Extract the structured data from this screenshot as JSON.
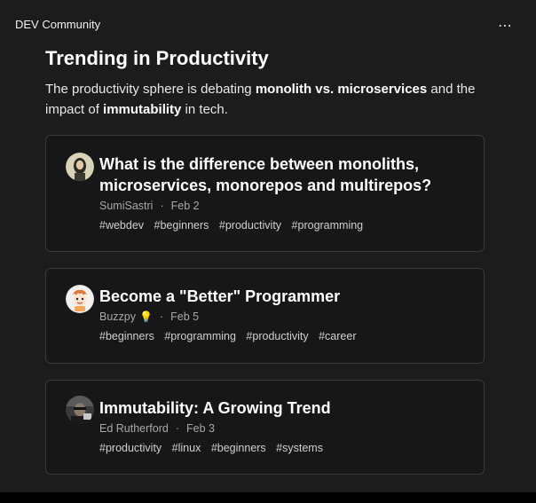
{
  "header": {
    "title": "DEV Community",
    "menu_icon": "⋯"
  },
  "section": {
    "title": "Trending in Productivity",
    "summary_parts": [
      "The productivity sphere is debating ",
      "monolith vs. microservices",
      " and the impact of ",
      "immutability",
      " in tech."
    ]
  },
  "posts": [
    {
      "title": "What is the difference between monoliths, microservices, monorepos and multirepos?",
      "author": "SumiSastri",
      "date": "Feb 2",
      "tags": [
        "#webdev",
        "#beginners",
        "#productivity",
        "#programming"
      ]
    },
    {
      "title": "Become a \"Better\" Programmer",
      "author": "Buzzpy",
      "author_badge": "💡",
      "date": "Feb 5",
      "tags": [
        "#beginners",
        "#programming",
        "#productivity",
        "#career"
      ]
    },
    {
      "title": "Immutability: A Growing Trend",
      "author": "Ed Rutherford",
      "date": "Feb 3",
      "tags": [
        "#productivity",
        "#linux",
        "#beginners",
        "#systems"
      ]
    }
  ],
  "meta_separator": "·"
}
